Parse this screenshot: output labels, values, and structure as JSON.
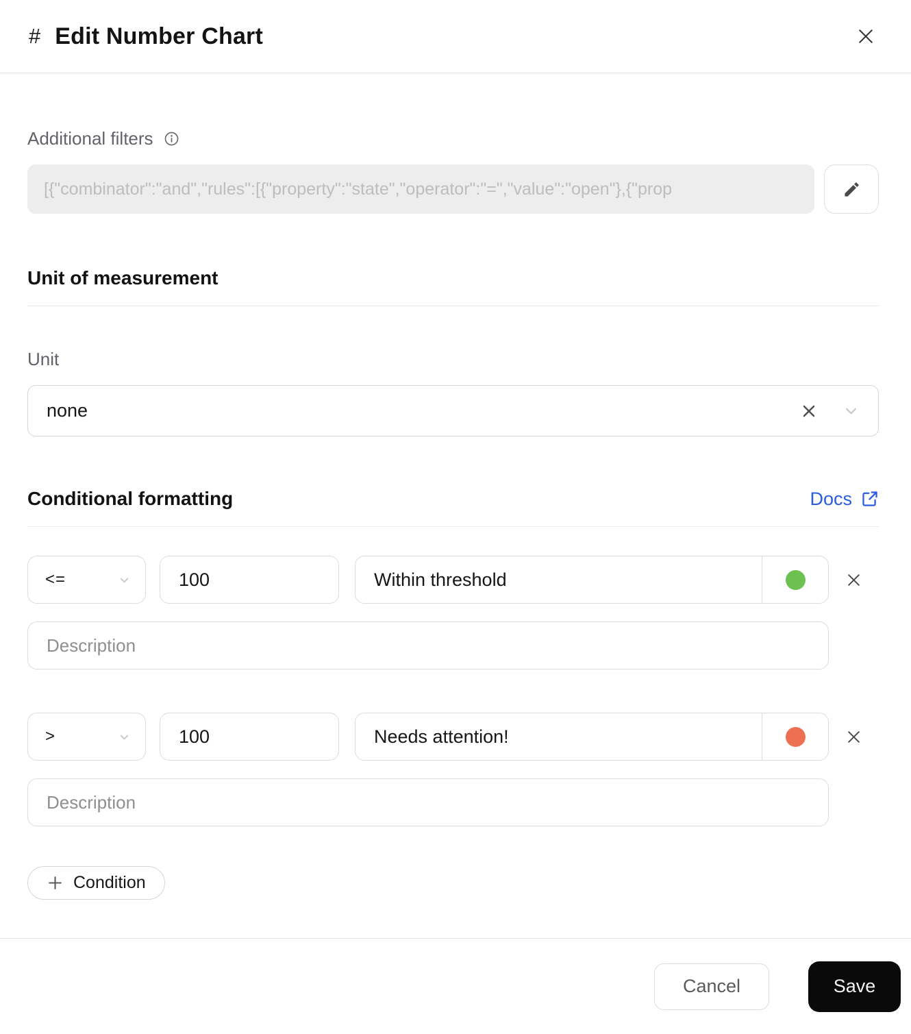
{
  "header": {
    "type_icon": "#",
    "title": "Edit Number Chart"
  },
  "filters": {
    "label": "Additional filters",
    "value": "[{\"combinator\":\"and\",\"rules\":[{\"property\":\"state\",\"operator\":\"=\",\"value\":\"open\"},{\"prop"
  },
  "unit_section": {
    "heading": "Unit of measurement",
    "field_label": "Unit",
    "selected_value": "none"
  },
  "formatting": {
    "heading": "Conditional formatting",
    "docs_link": "Docs",
    "conditions": [
      {
        "operator": "<=",
        "value": "100",
        "label": "Within threshold",
        "color": "#6CC150",
        "description_placeholder": "Description"
      },
      {
        "operator": ">",
        "value": "100",
        "label": "Needs attention!",
        "color": "#EE7053",
        "description_placeholder": "Description"
      }
    ],
    "add_condition_label": "Condition"
  },
  "footer": {
    "cancel": "Cancel",
    "save": "Save"
  }
}
